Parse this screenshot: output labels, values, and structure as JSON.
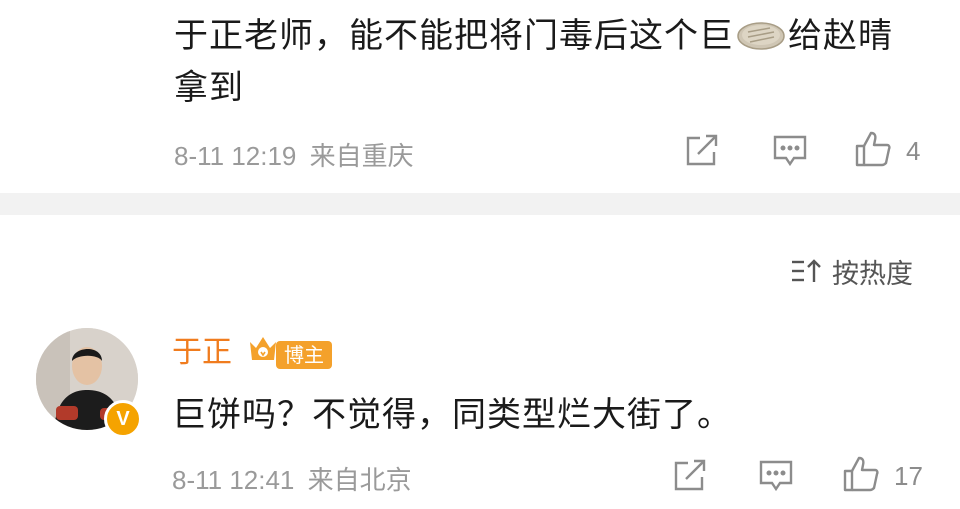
{
  "comment1": {
    "text_before_icon": "于正老师，能不能把将门毒后这个巨",
    "inline_icon": "pancake-emoji-icon",
    "text_after_icon": "给赵晴拿到",
    "time": "8-11 12:19",
    "source": "来自重庆",
    "like_count": "4"
  },
  "sort": {
    "icon": "sort-icon",
    "label": "按热度"
  },
  "comment2": {
    "username": "于正",
    "badge_label": "博主",
    "verified_mark": "V",
    "text": "巨饼吗？不觉得，同类型烂大街了。",
    "time": "8-11 12:41",
    "source": "来自北京",
    "like_count": "17"
  },
  "colors": {
    "username": "#f07c1e",
    "badge": "#f4a12b",
    "verified": "#f5a300",
    "meta": "#9a9a9a",
    "divider": "#f2f2f2"
  }
}
